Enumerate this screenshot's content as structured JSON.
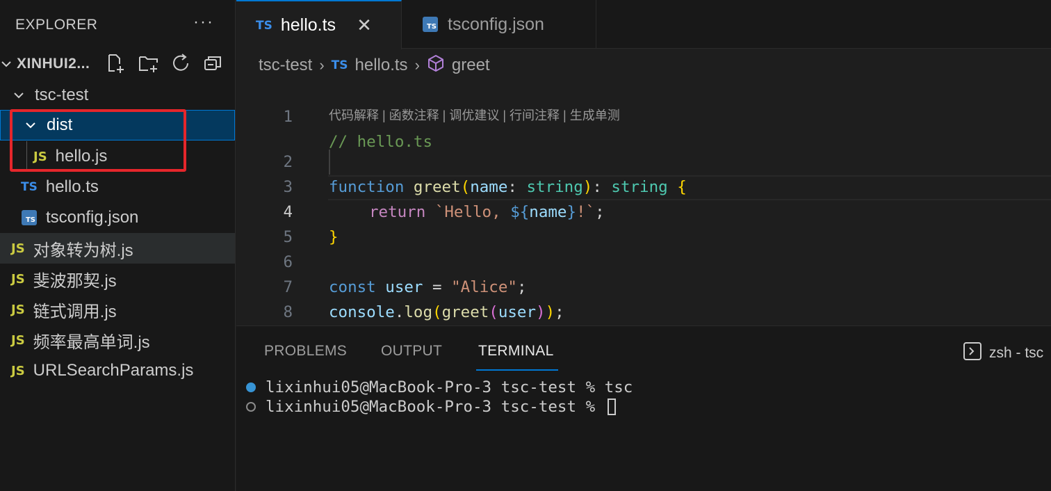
{
  "sidebar": {
    "title": "EXPLORER",
    "more": "···",
    "workspace": "XINHUI2...",
    "tree": [
      {
        "label": "tsc-test",
        "kind": "folder"
      },
      {
        "label": "dist",
        "kind": "folder"
      },
      {
        "label": "hello.js",
        "kind": "js",
        "badge": "JS"
      },
      {
        "label": "hello.ts",
        "kind": "ts",
        "badge": "TS"
      },
      {
        "label": "tsconfig.json",
        "kind": "json",
        "badge": "TS"
      },
      {
        "label": "对象转为树.js",
        "kind": "js",
        "badge": "JS"
      },
      {
        "label": "斐波那契.js",
        "kind": "js",
        "badge": "JS"
      },
      {
        "label": "链式调用.js",
        "kind": "js",
        "badge": "JS"
      },
      {
        "label": "频率最高单词.js",
        "kind": "js",
        "badge": "JS"
      },
      {
        "label": "URLSearchParams.js",
        "kind": "js",
        "badge": "JS"
      }
    ]
  },
  "tabs": [
    {
      "label": "hello.ts",
      "badge": "TS",
      "close": "✕"
    },
    {
      "label": "tsconfig.json",
      "badge": "TS"
    }
  ],
  "breadcrumb": {
    "folder": "tsc-test",
    "file_badge": "TS",
    "file": "hello.ts",
    "symbol": "greet",
    "sep": "›"
  },
  "editor": {
    "line_numbers": [
      "1",
      "2",
      "3",
      "4",
      "5",
      "6",
      "7",
      "8"
    ],
    "codelens": "代码解释 | 函数注释 | 调优建议 | 行间注释 | 生成单测",
    "tokens": {
      "l1_comment": "// hello.ts",
      "l2_function": "function",
      "l2_greet": "greet",
      "l2_paren_open": "(",
      "l2_name": "name",
      "l2_colon1": ": ",
      "l2_string1": "string",
      "l2_paren_close": ")",
      "l2_colon2": ": ",
      "l2_string2": "string",
      "l2_brace": " {",
      "l3_return": "return",
      "l3_tpl1": " `Hello, ",
      "l3_interp_open": "${",
      "l3_name": "name",
      "l3_interp_close": "}",
      "l3_tpl2": "!`",
      "l3_semi": ";",
      "l4_brace": "}",
      "l6_const": "const",
      "l6_user": "user",
      "l6_eq": " = ",
      "l6_str": "\"Alice\"",
      "l6_semi": ";",
      "l7_console": "console",
      "l7_dot": ".",
      "l7_log": "log",
      "l7_p1": "(",
      "l7_greet": "greet",
      "l7_p2": "(",
      "l7_user": "user",
      "l7_p3": ")",
      "l7_p4": ")",
      "l7_semi": ";"
    }
  },
  "panel": {
    "tabs": [
      "PROBLEMS",
      "OUTPUT",
      "TERMINAL"
    ],
    "active_tab": "TERMINAL",
    "terminal_name": "zsh - tsc",
    "lines": [
      "lixinhui05@MacBook-Pro-3 tsc-test % tsc",
      "lixinhui05@MacBook-Pro-3 tsc-test % "
    ]
  },
  "colors": {
    "accent": "#0078d4",
    "highlight_box": "#e5262b",
    "selection": "#04395e"
  }
}
